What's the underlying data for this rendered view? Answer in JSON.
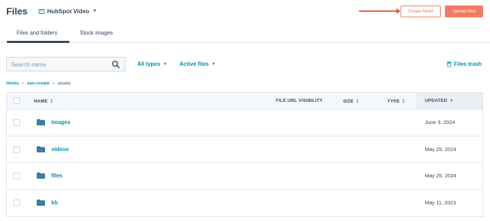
{
  "header": {
    "title": "Files",
    "account": "HubSpot Video",
    "create_folder": "Create folder",
    "upload_files": "Upload files"
  },
  "tabs": [
    {
      "label": "Files and folders",
      "active": true
    },
    {
      "label": "Stock images",
      "active": false
    }
  ],
  "toolbar": {
    "search_placeholder": "Search name",
    "filter_types": "All types",
    "filter_status": "Active files",
    "trash": "Files trash"
  },
  "breadcrumb": [
    "Home",
    "xen-create",
    "assets"
  ],
  "table": {
    "columns": {
      "name": "NAME",
      "visibility": "FILE URL VISIBILITY",
      "size": "SIZE",
      "type": "TYPE",
      "updated": "UPDATED"
    },
    "rows": [
      {
        "name": "images",
        "updated": "June 3, 2024"
      },
      {
        "name": "videos",
        "updated": "May 25, 2024"
      },
      {
        "name": "files",
        "updated": "May 25, 2024"
      },
      {
        "name": "kb",
        "updated": "May 11, 2023"
      }
    ]
  },
  "colors": {
    "accent": "#f07a5e",
    "link": "#0091ae",
    "text": "#33475b",
    "folder": "#3b7ea1"
  }
}
